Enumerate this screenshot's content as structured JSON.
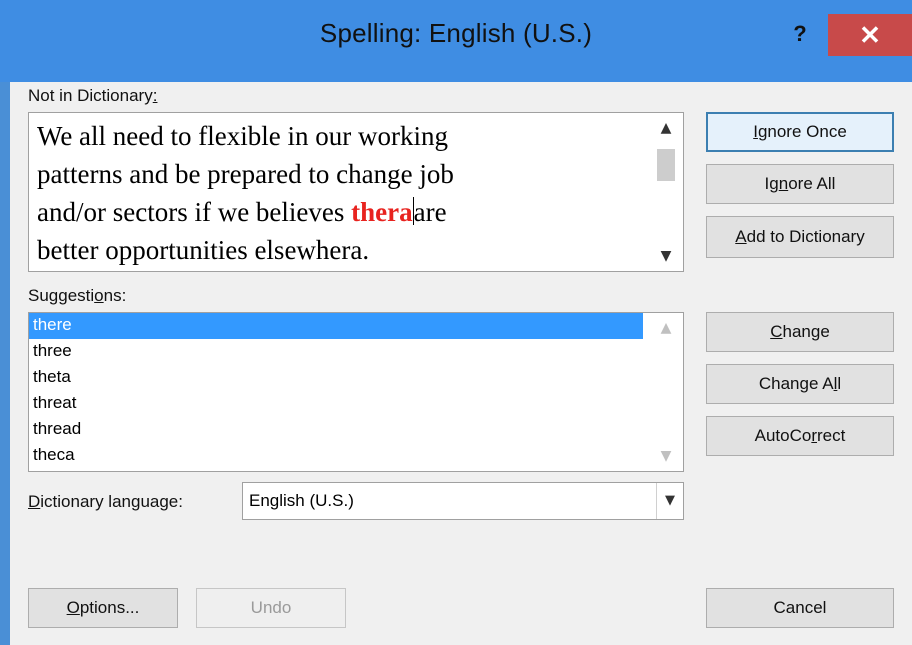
{
  "window": {
    "title": "Spelling: English (U.S.)",
    "help_label": "?",
    "close_label": "✕",
    "accent": "#3f8de3",
    "close_color": "#c84a4a"
  },
  "not_in_dictionary": {
    "label": "Not in Dictionary",
    "label_key": ":",
    "line1": "We all need to flexible in our working",
    "line2": "patterns and be prepared to change job",
    "line3_pre": "and/or sectors if we believes ",
    "line3_error": "thera",
    "line3_post": "are",
    "line4": "better opportunities elsewhera.",
    "error_color": "#e8231f"
  },
  "suggestions": {
    "label_pre": "Suggesti",
    "label_key": "o",
    "label_post": "ns:",
    "items": [
      "there",
      "three",
      "theta",
      "threat",
      "thread",
      "theca"
    ],
    "selected": "there",
    "selection_color": "#3399ff"
  },
  "dictionary_language": {
    "label_key": "D",
    "label_rest": "ictionary language:",
    "value": "English (U.S.)"
  },
  "buttons": {
    "ignore_once": {
      "key": "I",
      "rest": "gnore Once"
    },
    "ignore_all": {
      "pre": "Ig",
      "key": "n",
      "rest": "ore All"
    },
    "add_to_dictionary": {
      "key": "A",
      "rest": "dd to Dictionary"
    },
    "change": {
      "key": "C",
      "rest": "hange"
    },
    "change_all": {
      "pre": "Change A",
      "key": "l",
      "rest": "l"
    },
    "autocorrect": {
      "pre": "AutoCo",
      "key": "r",
      "rest": "rect"
    },
    "options": {
      "key": "O",
      "rest": "ptions..."
    },
    "undo": "Undo",
    "cancel": "Cancel"
  },
  "icons": {
    "scroll_up": "scroll-up-icon",
    "scroll_down": "scroll-down-icon",
    "combo_arrow": "chevron-down-icon"
  }
}
